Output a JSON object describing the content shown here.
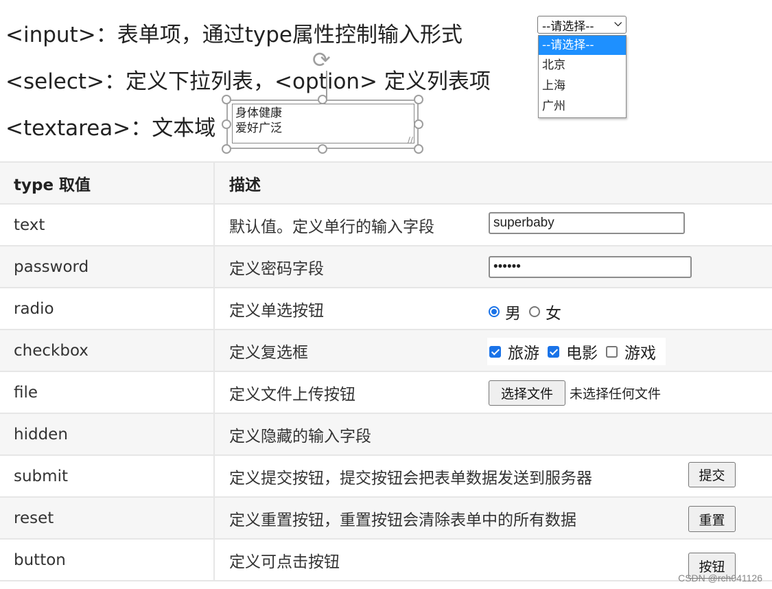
{
  "headlines": {
    "input_line": "<input>：表单项，通过type属性控制输入形式",
    "select_line": "<select>：定义下拉列表，<option> 定义列表项",
    "textarea_line": "<textarea>：文本域"
  },
  "select_demo": {
    "selected": "--请选择--",
    "options": [
      "--请选择--",
      "北京",
      "上海",
      "广州"
    ],
    "highlighted_index": 0
  },
  "textarea_demo": {
    "value": "身体健康\n爱好广泛"
  },
  "table": {
    "headers": [
      "type 取值",
      "描述"
    ],
    "rows": [
      {
        "type": "text",
        "desc": "默认值。定义单行的输入字段"
      },
      {
        "type": "password",
        "desc": "定义密码字段"
      },
      {
        "type": "radio",
        "desc": "定义单选按钮"
      },
      {
        "type": "checkbox",
        "desc": "定义复选框"
      },
      {
        "type": "file",
        "desc": "定义文件上传按钮"
      },
      {
        "type": "hidden",
        "desc": "定义隐藏的输入字段"
      },
      {
        "type": "submit",
        "desc": "定义提交按钮，提交按钮会把表单数据发送到服务器"
      },
      {
        "type": "reset",
        "desc": "定义重置按钮，重置按钮会清除表单中的所有数据"
      },
      {
        "type": "button",
        "desc": "定义可点击按钮"
      }
    ]
  },
  "demos": {
    "text_value": "superbaby",
    "password_value": "••••••",
    "radio": [
      {
        "label": "男",
        "checked": true
      },
      {
        "label": "女",
        "checked": false
      }
    ],
    "checkbox": [
      {
        "label": "旅游",
        "checked": true
      },
      {
        "label": "电影",
        "checked": true
      },
      {
        "label": "游戏",
        "checked": false
      }
    ],
    "file_button": "选择文件",
    "file_status": "未选择任何文件",
    "submit_label": "提交",
    "reset_label": "重置",
    "button_label": "按钮"
  },
  "colors": {
    "accent": "#1a73e8",
    "option_highlight": "#1e90ff",
    "row_alt": "#f6f6f6",
    "border": "#e6e6e6"
  },
  "watermark": "CSDN @rch041126"
}
